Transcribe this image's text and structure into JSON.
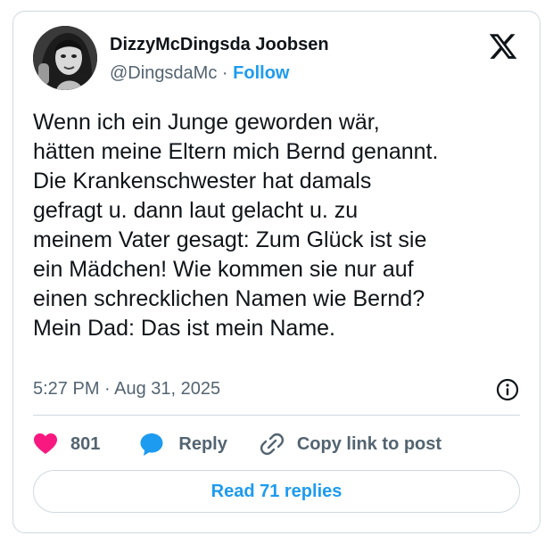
{
  "author": {
    "display_name": "DizzyMcDingsda Joobsen",
    "handle": "@DingsdaMc",
    "separator": "·",
    "follow_label": "Follow"
  },
  "tweet": {
    "lines": [
      "Wenn ich ein Junge geworden wär,",
      "hätten meine Eltern mich Bernd genannt.",
      "Die Krankenschwester hat damals",
      "gefragt u. dann laut gelacht u. zu",
      "meinem Vater gesagt: Zum Glück ist sie",
      "ein Mädchen! Wie kommen sie nur auf",
      "einen schrecklichen Namen wie Bernd?",
      "Mein Dad: Das ist mein Name."
    ],
    "timestamp": "5:27 PM · Aug 31, 2025"
  },
  "actions": {
    "like_count": "801",
    "reply_label": "Reply",
    "copy_label": "Copy link to post"
  },
  "read_replies_label": "Read 71 replies",
  "icons": {
    "logo": "x-logo-icon",
    "info": "info-icon",
    "like": "heart-icon",
    "reply": "speech-bubble-icon",
    "copy": "link-icon"
  },
  "colors": {
    "accent": "#1d9bf0",
    "like": "#f91880",
    "secondary_text": "#536471",
    "border": "#cfd9de"
  }
}
